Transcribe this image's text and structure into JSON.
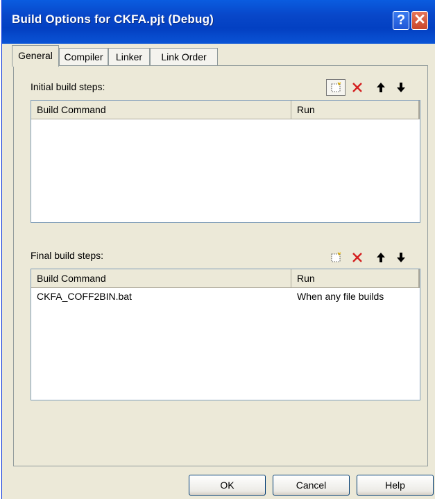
{
  "window": {
    "title": "Build Options for CKFA.pjt (Debug)",
    "help_glyph": "?",
    "close_glyph": "✕"
  },
  "tabs": [
    "General",
    "Compiler",
    "Linker",
    "Link Order"
  ],
  "active_tab": "General",
  "initial_steps": {
    "label": "Initial build steps:",
    "columns": [
      "Build Command",
      "Run"
    ],
    "rows": []
  },
  "final_steps": {
    "label": "Final build steps:",
    "columns": [
      "Build Command",
      "Run"
    ],
    "rows": [
      {
        "command": "CKFA_COFF2BIN.bat",
        "run": "When any file builds"
      }
    ]
  },
  "toolbar_icons": [
    "new-icon",
    "delete-icon",
    "move-up-icon",
    "move-down-icon"
  ],
  "buttons": {
    "ok": "OK",
    "cancel": "Cancel",
    "help": "Help"
  },
  "colors": {
    "titlebar": "#0847c9",
    "dialog_bg": "#ece9d8",
    "delete_red": "#d42020"
  }
}
